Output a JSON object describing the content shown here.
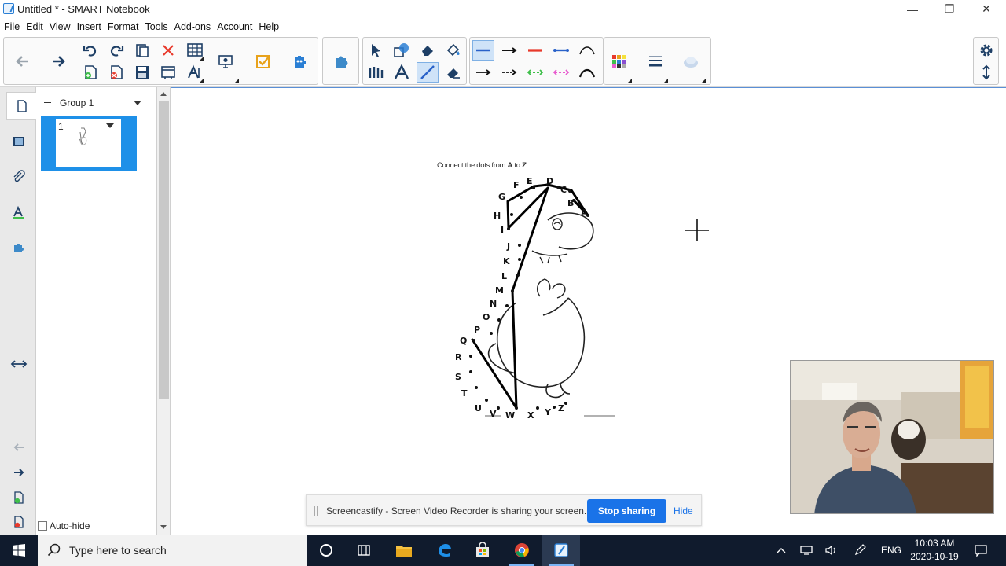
{
  "window": {
    "title": "Untitled * - SMART Notebook",
    "minimize_glyph": "—",
    "restore_glyph": "❐",
    "close_glyph": "✕"
  },
  "menu": [
    "File",
    "Edit",
    "View",
    "Insert",
    "Format",
    "Tools",
    "Add-ons",
    "Account",
    "Help"
  ],
  "toolbar": {
    "icons": [
      "back-arrow-icon",
      "forward-arrow-icon",
      "undo-icon",
      "redo-icon",
      "paste-icon",
      "delete-icon",
      "table-icon",
      "add-page-icon",
      "delete-page-icon",
      "save-icon",
      "screen-shade-icon",
      "text-tool-icon",
      "display-icon",
      "response-check-icon",
      "activity-builder-icon",
      "add-ons-puzzle-icon",
      "select-arrow-icon",
      "shapes-icon",
      "eraser-fill-icon",
      "fill-bucket-icon",
      "pen-tool-icon",
      "text-a-icon",
      "line-tool-icon",
      "eraser-icon",
      "color-palette-icon",
      "line-properties-icon",
      "fill-effect-icon",
      "settings-gear-icon",
      "toolbar-position-icon"
    ],
    "line_styles": [
      "solid-thin-blue",
      "solid-arrow-black",
      "solid-red",
      "dash-blue-arrow",
      "arc",
      "solid-black",
      "dash-black-arrow",
      "dash-green-arrow",
      "dash-pink-arrow",
      "arc-black"
    ],
    "colors": {
      "accent": "#2b7fd4",
      "red": "#e8392b",
      "blue": "#2a62c9",
      "green": "#3fbf4a",
      "pink": "#e85ccf"
    }
  },
  "sidebar": {
    "tabs": [
      "page-sorter-icon",
      "gallery-icon",
      "attachments-icon",
      "properties-icon",
      "add-ons-icon"
    ],
    "group_label": "Group 1",
    "page_number": "1",
    "autohide_label": "Auto-hide"
  },
  "canvas": {
    "instruction_prefix": "Connect the dots from ",
    "instruction_a": "A",
    "instruction_mid": " to ",
    "instruction_z": "Z",
    "instruction_end": ".",
    "letters": [
      "A",
      "B",
      "C",
      "D",
      "E",
      "F",
      "G",
      "H",
      "I",
      "J",
      "K",
      "L",
      "M",
      "N",
      "O",
      "P",
      "Q",
      "R",
      "S",
      "T",
      "U",
      "V",
      "W",
      "X",
      "Y",
      "Z"
    ]
  },
  "share_bar": {
    "message": "Screencastify - Screen Video Recorder is sharing your screen.",
    "stop_label": "Stop sharing",
    "hide_label": "Hide"
  },
  "taskbar": {
    "search_placeholder": "Type here to search",
    "language": "ENG",
    "time": "10:03 AM",
    "date": "2020-10-19"
  }
}
